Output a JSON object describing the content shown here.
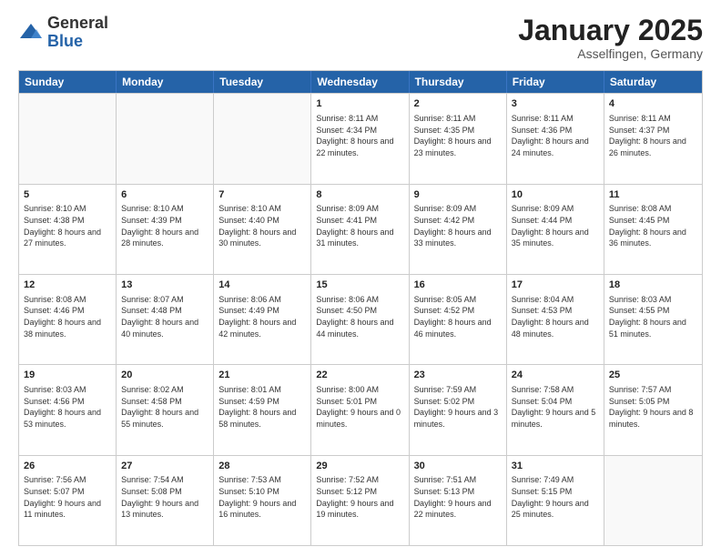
{
  "logo": {
    "general": "General",
    "blue": "Blue"
  },
  "header": {
    "month": "January 2025",
    "location": "Asselfingen, Germany"
  },
  "weekdays": [
    "Sunday",
    "Monday",
    "Tuesday",
    "Wednesday",
    "Thursday",
    "Friday",
    "Saturday"
  ],
  "rows": [
    [
      {
        "day": "",
        "sunrise": "",
        "sunset": "",
        "daylight": ""
      },
      {
        "day": "",
        "sunrise": "",
        "sunset": "",
        "daylight": ""
      },
      {
        "day": "",
        "sunrise": "",
        "sunset": "",
        "daylight": ""
      },
      {
        "day": "1",
        "sunrise": "Sunrise: 8:11 AM",
        "sunset": "Sunset: 4:34 PM",
        "daylight": "Daylight: 8 hours and 22 minutes."
      },
      {
        "day": "2",
        "sunrise": "Sunrise: 8:11 AM",
        "sunset": "Sunset: 4:35 PM",
        "daylight": "Daylight: 8 hours and 23 minutes."
      },
      {
        "day": "3",
        "sunrise": "Sunrise: 8:11 AM",
        "sunset": "Sunset: 4:36 PM",
        "daylight": "Daylight: 8 hours and 24 minutes."
      },
      {
        "day": "4",
        "sunrise": "Sunrise: 8:11 AM",
        "sunset": "Sunset: 4:37 PM",
        "daylight": "Daylight: 8 hours and 26 minutes."
      }
    ],
    [
      {
        "day": "5",
        "sunrise": "Sunrise: 8:10 AM",
        "sunset": "Sunset: 4:38 PM",
        "daylight": "Daylight: 8 hours and 27 minutes."
      },
      {
        "day": "6",
        "sunrise": "Sunrise: 8:10 AM",
        "sunset": "Sunset: 4:39 PM",
        "daylight": "Daylight: 8 hours and 28 minutes."
      },
      {
        "day": "7",
        "sunrise": "Sunrise: 8:10 AM",
        "sunset": "Sunset: 4:40 PM",
        "daylight": "Daylight: 8 hours and 30 minutes."
      },
      {
        "day": "8",
        "sunrise": "Sunrise: 8:09 AM",
        "sunset": "Sunset: 4:41 PM",
        "daylight": "Daylight: 8 hours and 31 minutes."
      },
      {
        "day": "9",
        "sunrise": "Sunrise: 8:09 AM",
        "sunset": "Sunset: 4:42 PM",
        "daylight": "Daylight: 8 hours and 33 minutes."
      },
      {
        "day": "10",
        "sunrise": "Sunrise: 8:09 AM",
        "sunset": "Sunset: 4:44 PM",
        "daylight": "Daylight: 8 hours and 35 minutes."
      },
      {
        "day": "11",
        "sunrise": "Sunrise: 8:08 AM",
        "sunset": "Sunset: 4:45 PM",
        "daylight": "Daylight: 8 hours and 36 minutes."
      }
    ],
    [
      {
        "day": "12",
        "sunrise": "Sunrise: 8:08 AM",
        "sunset": "Sunset: 4:46 PM",
        "daylight": "Daylight: 8 hours and 38 minutes."
      },
      {
        "day": "13",
        "sunrise": "Sunrise: 8:07 AM",
        "sunset": "Sunset: 4:48 PM",
        "daylight": "Daylight: 8 hours and 40 minutes."
      },
      {
        "day": "14",
        "sunrise": "Sunrise: 8:06 AM",
        "sunset": "Sunset: 4:49 PM",
        "daylight": "Daylight: 8 hours and 42 minutes."
      },
      {
        "day": "15",
        "sunrise": "Sunrise: 8:06 AM",
        "sunset": "Sunset: 4:50 PM",
        "daylight": "Daylight: 8 hours and 44 minutes."
      },
      {
        "day": "16",
        "sunrise": "Sunrise: 8:05 AM",
        "sunset": "Sunset: 4:52 PM",
        "daylight": "Daylight: 8 hours and 46 minutes."
      },
      {
        "day": "17",
        "sunrise": "Sunrise: 8:04 AM",
        "sunset": "Sunset: 4:53 PM",
        "daylight": "Daylight: 8 hours and 48 minutes."
      },
      {
        "day": "18",
        "sunrise": "Sunrise: 8:03 AM",
        "sunset": "Sunset: 4:55 PM",
        "daylight": "Daylight: 8 hours and 51 minutes."
      }
    ],
    [
      {
        "day": "19",
        "sunrise": "Sunrise: 8:03 AM",
        "sunset": "Sunset: 4:56 PM",
        "daylight": "Daylight: 8 hours and 53 minutes."
      },
      {
        "day": "20",
        "sunrise": "Sunrise: 8:02 AM",
        "sunset": "Sunset: 4:58 PM",
        "daylight": "Daylight: 8 hours and 55 minutes."
      },
      {
        "day": "21",
        "sunrise": "Sunrise: 8:01 AM",
        "sunset": "Sunset: 4:59 PM",
        "daylight": "Daylight: 8 hours and 58 minutes."
      },
      {
        "day": "22",
        "sunrise": "Sunrise: 8:00 AM",
        "sunset": "Sunset: 5:01 PM",
        "daylight": "Daylight: 9 hours and 0 minutes."
      },
      {
        "day": "23",
        "sunrise": "Sunrise: 7:59 AM",
        "sunset": "Sunset: 5:02 PM",
        "daylight": "Daylight: 9 hours and 3 minutes."
      },
      {
        "day": "24",
        "sunrise": "Sunrise: 7:58 AM",
        "sunset": "Sunset: 5:04 PM",
        "daylight": "Daylight: 9 hours and 5 minutes."
      },
      {
        "day": "25",
        "sunrise": "Sunrise: 7:57 AM",
        "sunset": "Sunset: 5:05 PM",
        "daylight": "Daylight: 9 hours and 8 minutes."
      }
    ],
    [
      {
        "day": "26",
        "sunrise": "Sunrise: 7:56 AM",
        "sunset": "Sunset: 5:07 PM",
        "daylight": "Daylight: 9 hours and 11 minutes."
      },
      {
        "day": "27",
        "sunrise": "Sunrise: 7:54 AM",
        "sunset": "Sunset: 5:08 PM",
        "daylight": "Daylight: 9 hours and 13 minutes."
      },
      {
        "day": "28",
        "sunrise": "Sunrise: 7:53 AM",
        "sunset": "Sunset: 5:10 PM",
        "daylight": "Daylight: 9 hours and 16 minutes."
      },
      {
        "day": "29",
        "sunrise": "Sunrise: 7:52 AM",
        "sunset": "Sunset: 5:12 PM",
        "daylight": "Daylight: 9 hours and 19 minutes."
      },
      {
        "day": "30",
        "sunrise": "Sunrise: 7:51 AM",
        "sunset": "Sunset: 5:13 PM",
        "daylight": "Daylight: 9 hours and 22 minutes."
      },
      {
        "day": "31",
        "sunrise": "Sunrise: 7:49 AM",
        "sunset": "Sunset: 5:15 PM",
        "daylight": "Daylight: 9 hours and 25 minutes."
      },
      {
        "day": "",
        "sunrise": "",
        "sunset": "",
        "daylight": ""
      }
    ]
  ]
}
